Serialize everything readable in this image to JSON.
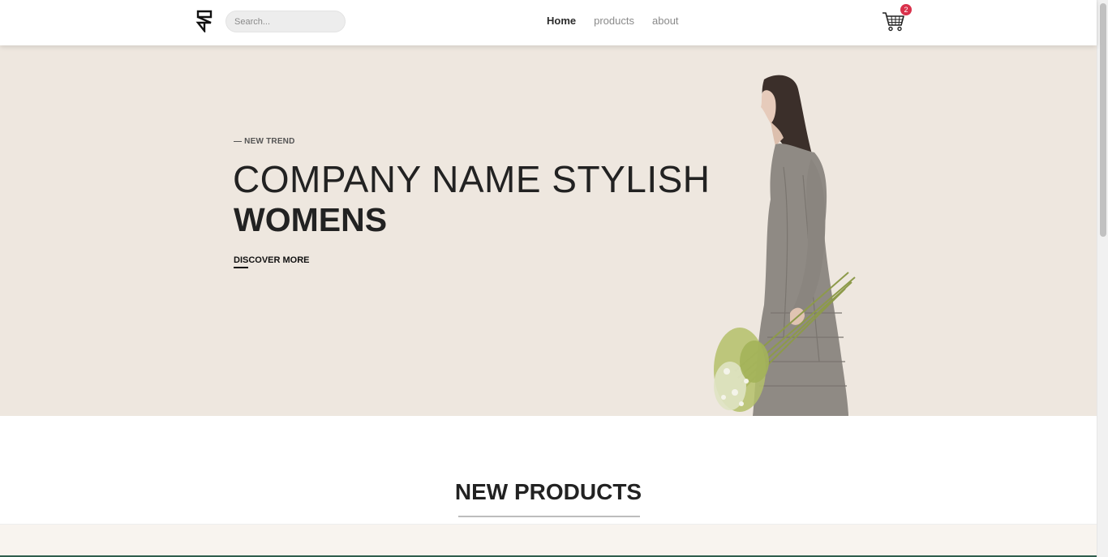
{
  "header": {
    "search_placeholder": "Search...",
    "nav": [
      {
        "label": "Home"
      },
      {
        "label": "products"
      },
      {
        "label": "about"
      }
    ],
    "cart_count": "2",
    "logo_icon": "framer-logo-icon",
    "cart_icon": "shopping-cart-icon"
  },
  "hero": {
    "eyebrow": "— NEW TREND",
    "title": "COMPANY NAME STYLISH",
    "subtitle": "WOMENS",
    "cta": "DISCOVER MORE",
    "background_color": "#eee7df"
  },
  "products": {
    "heading": "NEW PRODUCTS"
  },
  "colors": {
    "badge": "#d9314b",
    "text_dark": "#222222",
    "nav_muted": "#8a8a8a"
  }
}
